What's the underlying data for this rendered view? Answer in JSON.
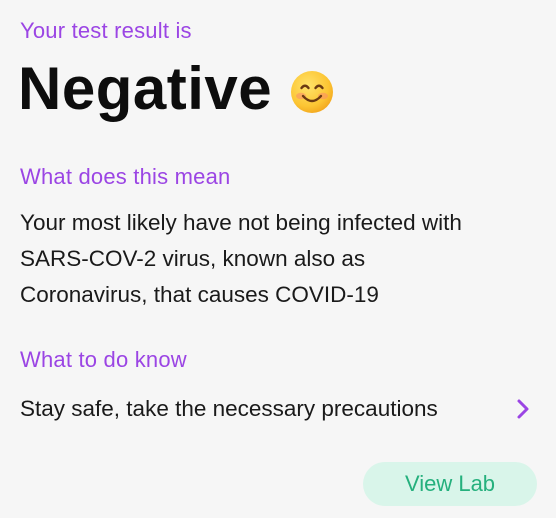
{
  "result": {
    "intro_label": "Your test result is",
    "value": "Negative",
    "emoji_icon": "smiling-face-icon"
  },
  "meaning": {
    "label": "What does this mean",
    "lines": [
      "Your most likely have not being infected with",
      "SARS-COV-2 virus, known also as",
      "Coronavirus, that causes COVID-19"
    ]
  },
  "next_steps": {
    "label": "What to do know",
    "item_text": "Stay safe, take the necessary precautions",
    "item_icon": "chevron-right-icon"
  },
  "actions": {
    "view_lab_label": "View Lab"
  },
  "colors": {
    "accent": "#9b45e4",
    "button_bg": "#d9f5ea",
    "button_text": "#25b07d"
  }
}
